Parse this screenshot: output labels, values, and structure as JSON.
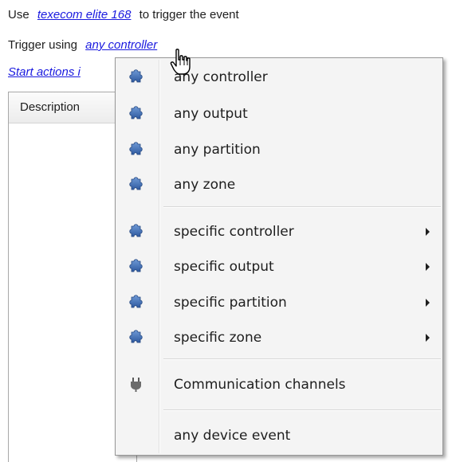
{
  "header": {
    "line1_prefix": "Use",
    "device_link": "texecom elite 168",
    "line1_suffix": "to trigger the event",
    "line2_prefix": "Trigger using",
    "trigger_link": "any controller",
    "line3_link": "Start actions i"
  },
  "panel": {
    "column_header": "Description"
  },
  "menu": {
    "items": [
      {
        "label": "any controller",
        "icon": "puzzle-icon",
        "submenu": false
      },
      {
        "label": "any output",
        "icon": "puzzle-icon",
        "submenu": false
      },
      {
        "label": "any partition",
        "icon": "puzzle-icon",
        "submenu": false
      },
      {
        "label": "any zone",
        "icon": "puzzle-icon",
        "submenu": false
      },
      {
        "label": "specific controller",
        "icon": "puzzle-icon",
        "submenu": true
      },
      {
        "label": "specific output",
        "icon": "puzzle-icon",
        "submenu": true
      },
      {
        "label": "specific partition",
        "icon": "puzzle-icon",
        "submenu": true
      },
      {
        "label": "specific zone",
        "icon": "puzzle-icon",
        "submenu": true
      },
      {
        "label": "Communication channels",
        "icon": "plug-icon",
        "submenu": false
      },
      {
        "label": "any device event",
        "icon": "",
        "submenu": false
      }
    ]
  },
  "colors": {
    "link": "#1a1adf",
    "menu_background": "#f4f4f4",
    "puzzle_icon": "#3d6fb8"
  }
}
